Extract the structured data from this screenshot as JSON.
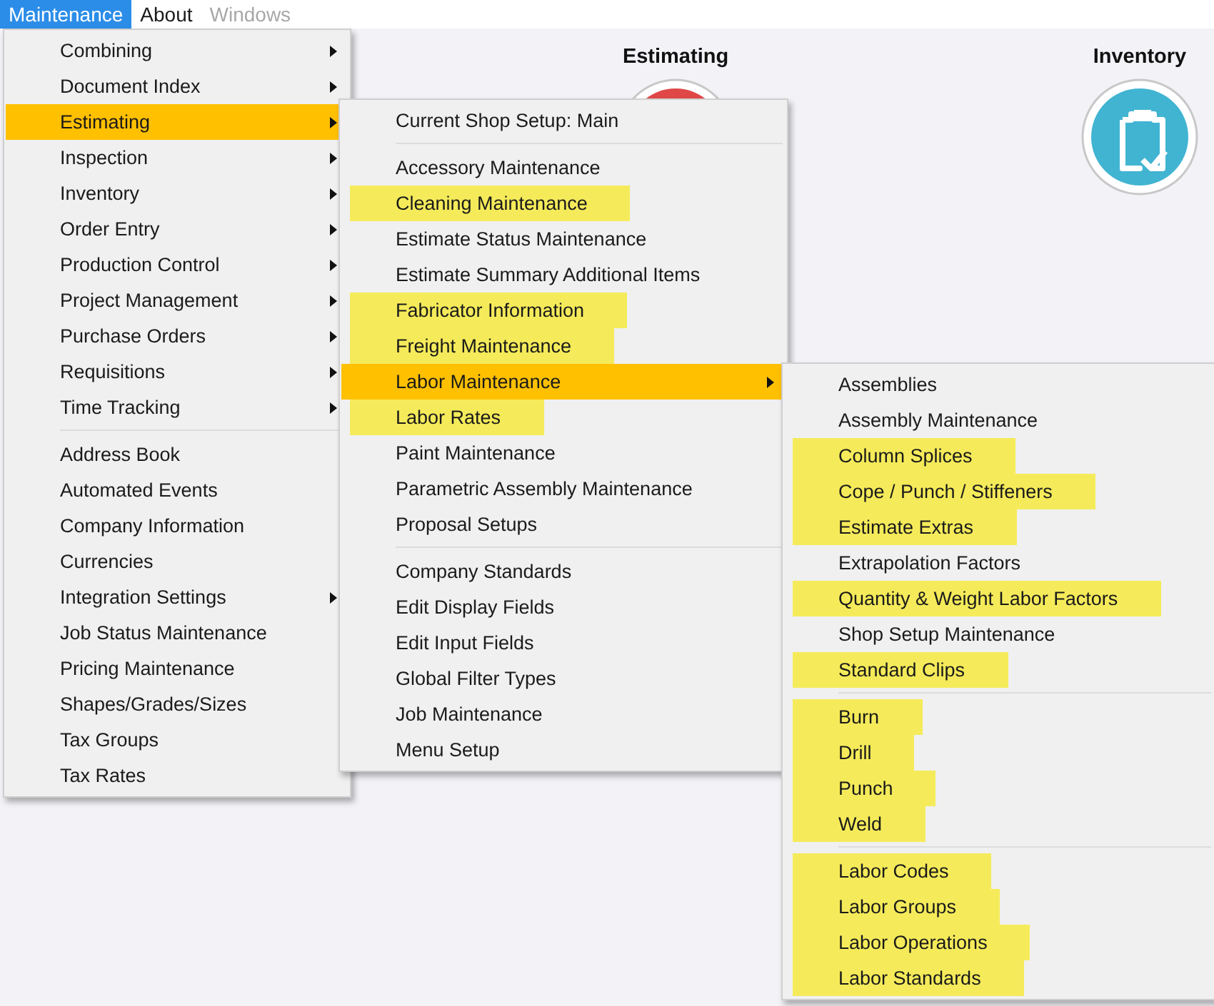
{
  "menu_bar": [
    {
      "label": "Maintenance",
      "selected": true,
      "disabled": false
    },
    {
      "label": "About",
      "selected": false,
      "disabled": false
    },
    {
      "label": "Windows",
      "selected": false,
      "disabled": true
    }
  ],
  "desktop_tiles": [
    {
      "label": "Estimating",
      "color": "#e04848"
    },
    {
      "label": "Inventory",
      "color": "#41b4d2"
    }
  ],
  "menus": [
    {
      "items": [
        {
          "kind": "item",
          "label": "Combining",
          "submenu": true,
          "selected": false,
          "highlighted": false
        },
        {
          "kind": "item",
          "label": "Document Index",
          "submenu": true,
          "selected": false,
          "highlighted": false
        },
        {
          "kind": "item",
          "label": "Estimating",
          "submenu": true,
          "selected": true,
          "highlighted": false
        },
        {
          "kind": "item",
          "label": "Inspection",
          "submenu": true,
          "selected": false,
          "highlighted": false
        },
        {
          "kind": "item",
          "label": "Inventory",
          "submenu": true,
          "selected": false,
          "highlighted": false
        },
        {
          "kind": "item",
          "label": "Order Entry",
          "submenu": true,
          "selected": false,
          "highlighted": false
        },
        {
          "kind": "item",
          "label": "Production Control",
          "submenu": true,
          "selected": false,
          "highlighted": false
        },
        {
          "kind": "item",
          "label": "Project Management",
          "submenu": true,
          "selected": false,
          "highlighted": false
        },
        {
          "kind": "item",
          "label": "Purchase Orders",
          "submenu": true,
          "selected": false,
          "highlighted": false
        },
        {
          "kind": "item",
          "label": "Requisitions",
          "submenu": true,
          "selected": false,
          "highlighted": false
        },
        {
          "kind": "item",
          "label": "Time Tracking",
          "submenu": true,
          "selected": false,
          "highlighted": false
        },
        {
          "kind": "separator"
        },
        {
          "kind": "item",
          "label": "Address Book",
          "submenu": false,
          "selected": false,
          "highlighted": false
        },
        {
          "kind": "item",
          "label": "Automated Events",
          "submenu": false,
          "selected": false,
          "highlighted": false
        },
        {
          "kind": "item",
          "label": "Company Information",
          "submenu": false,
          "selected": false,
          "highlighted": false
        },
        {
          "kind": "item",
          "label": "Currencies",
          "submenu": false,
          "selected": false,
          "highlighted": false
        },
        {
          "kind": "item",
          "label": "Integration Settings",
          "submenu": true,
          "selected": false,
          "highlighted": false
        },
        {
          "kind": "item",
          "label": "Job Status Maintenance",
          "submenu": false,
          "selected": false,
          "highlighted": false
        },
        {
          "kind": "item",
          "label": "Pricing Maintenance",
          "submenu": false,
          "selected": false,
          "highlighted": false
        },
        {
          "kind": "item",
          "label": "Shapes/Grades/Sizes",
          "submenu": false,
          "selected": false,
          "highlighted": false
        },
        {
          "kind": "item",
          "label": "Tax Groups",
          "submenu": false,
          "selected": false,
          "highlighted": false
        },
        {
          "kind": "item",
          "label": "Tax Rates",
          "submenu": false,
          "selected": false,
          "highlighted": false
        }
      ]
    },
    {
      "items": [
        {
          "kind": "item",
          "label": "Current Shop Setup: Main",
          "submenu": false,
          "selected": false,
          "highlighted": false
        },
        {
          "kind": "separator"
        },
        {
          "kind": "item",
          "label": "Accessory Maintenance",
          "submenu": false,
          "selected": false,
          "highlighted": false
        },
        {
          "kind": "item",
          "label": "Cleaning Maintenance",
          "submenu": false,
          "selected": false,
          "highlighted": true
        },
        {
          "kind": "item",
          "label": "Estimate Status Maintenance",
          "submenu": false,
          "selected": false,
          "highlighted": false
        },
        {
          "kind": "item",
          "label": "Estimate Summary Additional Items",
          "submenu": false,
          "selected": false,
          "highlighted": false
        },
        {
          "kind": "item",
          "label": "Fabricator Information",
          "submenu": false,
          "selected": false,
          "highlighted": true
        },
        {
          "kind": "item",
          "label": "Freight Maintenance",
          "submenu": false,
          "selected": false,
          "highlighted": true
        },
        {
          "kind": "item",
          "label": "Labor Maintenance",
          "submenu": true,
          "selected": true,
          "highlighted": false
        },
        {
          "kind": "item",
          "label": "Labor Rates",
          "submenu": false,
          "selected": false,
          "highlighted": true
        },
        {
          "kind": "item",
          "label": "Paint Maintenance",
          "submenu": false,
          "selected": false,
          "highlighted": false
        },
        {
          "kind": "item",
          "label": "Parametric Assembly Maintenance",
          "submenu": false,
          "selected": false,
          "highlighted": false
        },
        {
          "kind": "item",
          "label": "Proposal Setups",
          "submenu": false,
          "selected": false,
          "highlighted": false
        },
        {
          "kind": "separator"
        },
        {
          "kind": "item",
          "label": "Company Standards",
          "submenu": false,
          "selected": false,
          "highlighted": false
        },
        {
          "kind": "item",
          "label": "Edit Display Fields",
          "submenu": false,
          "selected": false,
          "highlighted": false
        },
        {
          "kind": "item",
          "label": "Edit Input Fields",
          "submenu": false,
          "selected": false,
          "highlighted": false
        },
        {
          "kind": "item",
          "label": "Global Filter Types",
          "submenu": false,
          "selected": false,
          "highlighted": false
        },
        {
          "kind": "item",
          "label": "Job Maintenance",
          "submenu": false,
          "selected": false,
          "highlighted": false
        },
        {
          "kind": "item",
          "label": "Menu Setup",
          "submenu": false,
          "selected": false,
          "highlighted": false
        }
      ]
    },
    {
      "items": [
        {
          "kind": "item",
          "label": "Assemblies",
          "submenu": false,
          "selected": false,
          "highlighted": false
        },
        {
          "kind": "item",
          "label": "Assembly Maintenance",
          "submenu": false,
          "selected": false,
          "highlighted": false
        },
        {
          "kind": "item",
          "label": "Column Splices",
          "submenu": false,
          "selected": false,
          "highlighted": true
        },
        {
          "kind": "item",
          "label": "Cope / Punch / Stiffeners",
          "submenu": false,
          "selected": false,
          "highlighted": true
        },
        {
          "kind": "item",
          "label": "Estimate Extras",
          "submenu": false,
          "selected": false,
          "highlighted": true
        },
        {
          "kind": "item",
          "label": "Extrapolation Factors",
          "submenu": false,
          "selected": false,
          "highlighted": false
        },
        {
          "kind": "item",
          "label": "Quantity & Weight Labor Factors",
          "submenu": false,
          "selected": false,
          "highlighted": true
        },
        {
          "kind": "item",
          "label": "Shop Setup Maintenance",
          "submenu": false,
          "selected": false,
          "highlighted": false
        },
        {
          "kind": "item",
          "label": "Standard Clips",
          "submenu": false,
          "selected": false,
          "highlighted": true
        },
        {
          "kind": "separator"
        },
        {
          "kind": "item",
          "label": "Burn",
          "submenu": false,
          "selected": false,
          "highlighted": true
        },
        {
          "kind": "item",
          "label": "Drill",
          "submenu": false,
          "selected": false,
          "highlighted": true
        },
        {
          "kind": "item",
          "label": "Punch",
          "submenu": false,
          "selected": false,
          "highlighted": true
        },
        {
          "kind": "item",
          "label": "Weld",
          "submenu": false,
          "selected": false,
          "highlighted": true
        },
        {
          "kind": "separator"
        },
        {
          "kind": "item",
          "label": "Labor Codes",
          "submenu": false,
          "selected": false,
          "highlighted": true
        },
        {
          "kind": "item",
          "label": "Labor Groups",
          "submenu": false,
          "selected": false,
          "highlighted": true
        },
        {
          "kind": "item",
          "label": "Labor Operations",
          "submenu": false,
          "selected": false,
          "highlighted": true
        },
        {
          "kind": "item",
          "label": "Labor Standards",
          "submenu": false,
          "selected": false,
          "highlighted": true
        }
      ]
    }
  ]
}
